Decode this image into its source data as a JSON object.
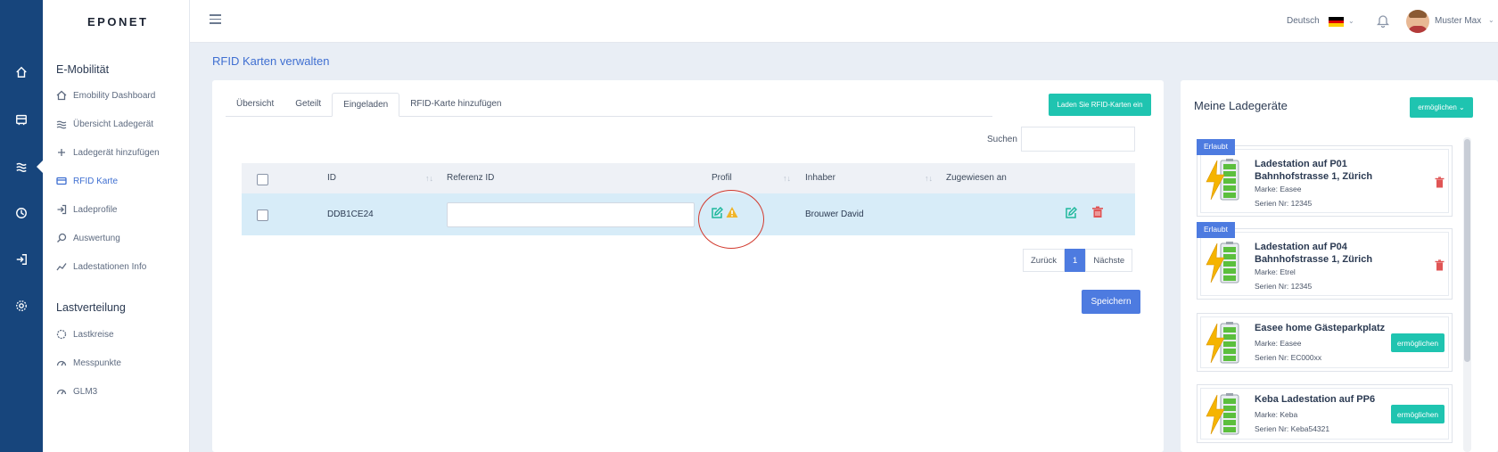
{
  "app": {
    "logo": "EPONET"
  },
  "header": {
    "language": "Deutsch",
    "user_name": "Muster Max",
    "colors": {
      "flag": [
        "#000000",
        "#dd0000",
        "#ffce00"
      ]
    }
  },
  "sidebar": {
    "section1": "E-Mobilität",
    "items1": [
      {
        "label": "Emobility Dashboard",
        "icon": "home-icon"
      },
      {
        "label": "Übersicht Ladegerät",
        "icon": "waves-icon"
      },
      {
        "label": "Ladegerät hinzufügen",
        "icon": "plus-icon"
      },
      {
        "label": "RFID Karte",
        "icon": "card-icon",
        "active": true
      },
      {
        "label": "Ladeprofile",
        "icon": "login-icon"
      },
      {
        "label": "Auswertung",
        "icon": "search-icon"
      },
      {
        "label": "Ladestationen Info",
        "icon": "chart-icon"
      }
    ],
    "section2": "Lastverteilung",
    "items2": [
      {
        "label": "Lastkreise",
        "icon": "circle-icon"
      },
      {
        "label": "Messpunkte",
        "icon": "gauge-icon"
      },
      {
        "label": "GLM3",
        "icon": "gauge-icon"
      }
    ]
  },
  "main": {
    "title": "RFID Karten verwalten",
    "tabs": [
      "Übersicht",
      "Geteilt",
      "Eingeladen",
      "RFID-Karte hinzufügen"
    ],
    "active_tab": 2,
    "load_button": "Laden Sie RFID-Karten ein",
    "search_label": "Suchen",
    "table": {
      "headers": [
        "ID",
        "Referenz ID",
        "Profil",
        "Inhaber",
        "Zugewiesen an"
      ],
      "rows": [
        {
          "id": "DDB1CE24",
          "referenz": "",
          "inhaber": "Brouwer David",
          "zugewiesen": ""
        }
      ]
    },
    "pagination": {
      "prev": "Zurück",
      "page": "1",
      "next": "Nächste"
    },
    "save_button": "Speichern"
  },
  "right_panel": {
    "title": "Meine Ladegeräte",
    "enable_button": "ermöglichen",
    "chargers": [
      {
        "badge": "Erlaubt",
        "title": "Ladestation auf P01 Bahnhofstrasse 1, Zürich",
        "brand": "Marke: Easee",
        "serial": "Serien Nr: 12345",
        "action": "trash"
      },
      {
        "badge": "Erlaubt",
        "title": "Ladestation auf P04 Bahnhofstrasse 1, Zürich",
        "brand": "Marke: Etrel",
        "serial": "Serien Nr: 12345",
        "action": "trash"
      },
      {
        "badge": "",
        "title": "Easee home Gästeparkplatz",
        "brand": "Marke: Easee",
        "serial": "Serien Nr: EC000xx",
        "action": "ermöglichen"
      },
      {
        "badge": "",
        "title": "Keba Ladestation auf PP6",
        "brand": "Marke: Keba",
        "serial": "Serien Nr: Keba54321",
        "action": "ermöglichen"
      }
    ]
  },
  "colors": {
    "rail": "#17457c",
    "accent": "#4d7be0",
    "teal": "#1fc4b0",
    "danger": "#e05555",
    "row_highlight": "#d7ecf8"
  }
}
